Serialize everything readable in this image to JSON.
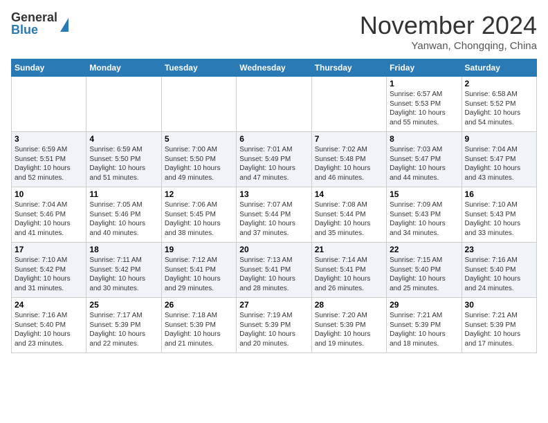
{
  "header": {
    "logo_general": "General",
    "logo_blue": "Blue",
    "month_title": "November 2024",
    "location": "Yanwan, Chongqing, China"
  },
  "days_of_week": [
    "Sunday",
    "Monday",
    "Tuesday",
    "Wednesday",
    "Thursday",
    "Friday",
    "Saturday"
  ],
  "weeks": [
    [
      {
        "day": "",
        "info": ""
      },
      {
        "day": "",
        "info": ""
      },
      {
        "day": "",
        "info": ""
      },
      {
        "day": "",
        "info": ""
      },
      {
        "day": "",
        "info": ""
      },
      {
        "day": "1",
        "info": "Sunrise: 6:57 AM\nSunset: 5:53 PM\nDaylight: 10 hours and 55 minutes."
      },
      {
        "day": "2",
        "info": "Sunrise: 6:58 AM\nSunset: 5:52 PM\nDaylight: 10 hours and 54 minutes."
      }
    ],
    [
      {
        "day": "3",
        "info": "Sunrise: 6:59 AM\nSunset: 5:51 PM\nDaylight: 10 hours and 52 minutes."
      },
      {
        "day": "4",
        "info": "Sunrise: 6:59 AM\nSunset: 5:50 PM\nDaylight: 10 hours and 51 minutes."
      },
      {
        "day": "5",
        "info": "Sunrise: 7:00 AM\nSunset: 5:50 PM\nDaylight: 10 hours and 49 minutes."
      },
      {
        "day": "6",
        "info": "Sunrise: 7:01 AM\nSunset: 5:49 PM\nDaylight: 10 hours and 47 minutes."
      },
      {
        "day": "7",
        "info": "Sunrise: 7:02 AM\nSunset: 5:48 PM\nDaylight: 10 hours and 46 minutes."
      },
      {
        "day": "8",
        "info": "Sunrise: 7:03 AM\nSunset: 5:47 PM\nDaylight: 10 hours and 44 minutes."
      },
      {
        "day": "9",
        "info": "Sunrise: 7:04 AM\nSunset: 5:47 PM\nDaylight: 10 hours and 43 minutes."
      }
    ],
    [
      {
        "day": "10",
        "info": "Sunrise: 7:04 AM\nSunset: 5:46 PM\nDaylight: 10 hours and 41 minutes."
      },
      {
        "day": "11",
        "info": "Sunrise: 7:05 AM\nSunset: 5:46 PM\nDaylight: 10 hours and 40 minutes."
      },
      {
        "day": "12",
        "info": "Sunrise: 7:06 AM\nSunset: 5:45 PM\nDaylight: 10 hours and 38 minutes."
      },
      {
        "day": "13",
        "info": "Sunrise: 7:07 AM\nSunset: 5:44 PM\nDaylight: 10 hours and 37 minutes."
      },
      {
        "day": "14",
        "info": "Sunrise: 7:08 AM\nSunset: 5:44 PM\nDaylight: 10 hours and 35 minutes."
      },
      {
        "day": "15",
        "info": "Sunrise: 7:09 AM\nSunset: 5:43 PM\nDaylight: 10 hours and 34 minutes."
      },
      {
        "day": "16",
        "info": "Sunrise: 7:10 AM\nSunset: 5:43 PM\nDaylight: 10 hours and 33 minutes."
      }
    ],
    [
      {
        "day": "17",
        "info": "Sunrise: 7:10 AM\nSunset: 5:42 PM\nDaylight: 10 hours and 31 minutes."
      },
      {
        "day": "18",
        "info": "Sunrise: 7:11 AM\nSunset: 5:42 PM\nDaylight: 10 hours and 30 minutes."
      },
      {
        "day": "19",
        "info": "Sunrise: 7:12 AM\nSunset: 5:41 PM\nDaylight: 10 hours and 29 minutes."
      },
      {
        "day": "20",
        "info": "Sunrise: 7:13 AM\nSunset: 5:41 PM\nDaylight: 10 hours and 28 minutes."
      },
      {
        "day": "21",
        "info": "Sunrise: 7:14 AM\nSunset: 5:41 PM\nDaylight: 10 hours and 26 minutes."
      },
      {
        "day": "22",
        "info": "Sunrise: 7:15 AM\nSunset: 5:40 PM\nDaylight: 10 hours and 25 minutes."
      },
      {
        "day": "23",
        "info": "Sunrise: 7:16 AM\nSunset: 5:40 PM\nDaylight: 10 hours and 24 minutes."
      }
    ],
    [
      {
        "day": "24",
        "info": "Sunrise: 7:16 AM\nSunset: 5:40 PM\nDaylight: 10 hours and 23 minutes."
      },
      {
        "day": "25",
        "info": "Sunrise: 7:17 AM\nSunset: 5:39 PM\nDaylight: 10 hours and 22 minutes."
      },
      {
        "day": "26",
        "info": "Sunrise: 7:18 AM\nSunset: 5:39 PM\nDaylight: 10 hours and 21 minutes."
      },
      {
        "day": "27",
        "info": "Sunrise: 7:19 AM\nSunset: 5:39 PM\nDaylight: 10 hours and 20 minutes."
      },
      {
        "day": "28",
        "info": "Sunrise: 7:20 AM\nSunset: 5:39 PM\nDaylight: 10 hours and 19 minutes."
      },
      {
        "day": "29",
        "info": "Sunrise: 7:21 AM\nSunset: 5:39 PM\nDaylight: 10 hours and 18 minutes."
      },
      {
        "day": "30",
        "info": "Sunrise: 7:21 AM\nSunset: 5:39 PM\nDaylight: 10 hours and 17 minutes."
      }
    ]
  ]
}
